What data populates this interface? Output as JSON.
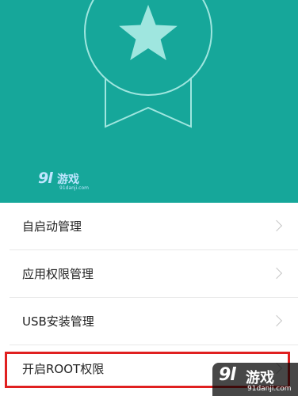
{
  "colors": {
    "header_bg": "#16a79a",
    "badge": "#9fe6df",
    "highlight": "#e02020"
  },
  "header": {
    "badge_icon": "star-ribbon-badge"
  },
  "watermark": {
    "logo": "9l",
    "name": "游戏",
    "url": "91danji.com"
  },
  "menu": {
    "items": [
      {
        "label": "自启动管理"
      },
      {
        "label": "应用权限管理"
      },
      {
        "label": "USB安装管理"
      },
      {
        "label": "开启ROOT权限"
      }
    ]
  }
}
